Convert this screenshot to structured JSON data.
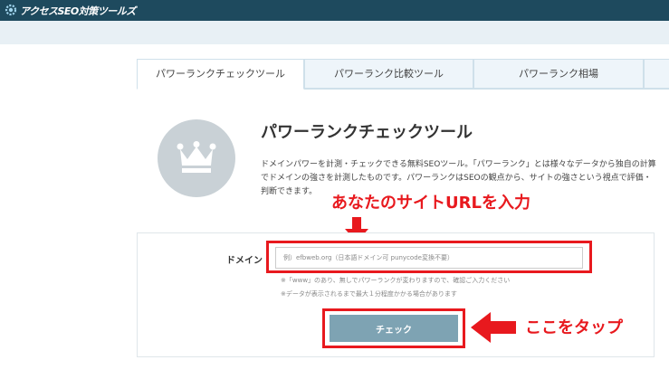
{
  "header": {
    "logo_text": "アクセスSEO対策ツールズ",
    "logo_icon": "gear-icon"
  },
  "tabs": [
    {
      "label": "パワーランクチェックツール",
      "active": true
    },
    {
      "label": "パワーランク比較ツール",
      "active": false
    },
    {
      "label": "パワーランク相場",
      "active": false
    }
  ],
  "main": {
    "icon": "crown-icon",
    "title": "パワーランクチェックツール",
    "description": "ドメインパワーを計測・チェックできる無料SEOツール。「パワーランク」とは様々なデータから独自の計算でドメインの強さを計測したものです。パワーランクはSEOの観点から、サイトの強さという視点で評価・判断できます。"
  },
  "form": {
    "domain_label": "ドメイン",
    "domain_placeholder": "例）efbweb.org（日本語ドメイン可 punycode変換不要）",
    "domain_value": "",
    "note1": "※「www」のあり、無しでパワーランクが変わりますので、確認ご入力ください",
    "note2": "※データが表示されるまで最大１分程度かかる場合があります",
    "check_label": "チェック"
  },
  "annotations": {
    "url_hint": "あなたのサイトURLを入力",
    "tap_hint": "ここをタップ",
    "color": "#e8191e"
  },
  "colors": {
    "header_bg": "#1e4a5e",
    "subbar_bg": "#e8f0f5",
    "tab_bg": "#eef5fa",
    "button_bg": "#7ea3b3",
    "icon_circle": "#c9d1d6"
  }
}
